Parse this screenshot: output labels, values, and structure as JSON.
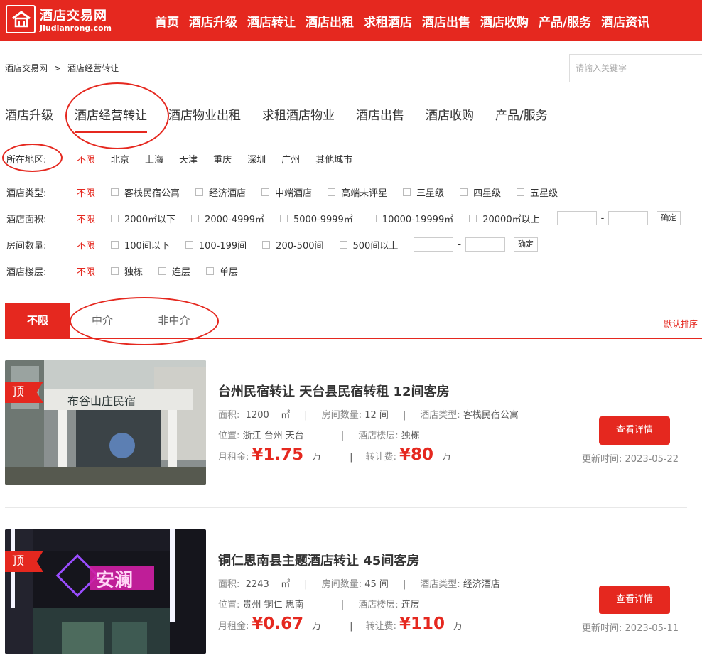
{
  "header": {
    "logo_cn": "酒店交易网",
    "logo_en": "Jiudianrong.com",
    "nav": [
      "首页",
      "酒店升级",
      "酒店转让",
      "酒店出租",
      "求租酒店",
      "酒店出售",
      "酒店收购",
      "产品/服务",
      "酒店资讯"
    ]
  },
  "breadcrumb": {
    "home": "酒店交易网",
    "sep": ">",
    "current": "酒店经营转让"
  },
  "search": {
    "placeholder": "请输入关键字"
  },
  "category_tabs": [
    "酒店升级",
    "酒店经营转让",
    "酒店物业出租",
    "求租酒店物业",
    "酒店出售",
    "酒店收购",
    "产品/服务"
  ],
  "filters": {
    "region": {
      "label": "所在地区:",
      "options": [
        "不限",
        "北京",
        "上海",
        "天津",
        "重庆",
        "深圳",
        "广州",
        "其他城市"
      ]
    },
    "type": {
      "label": "酒店类型:",
      "any": "不限",
      "options": [
        "客栈民宿公寓",
        "经济酒店",
        "中端酒店",
        "高端未评星",
        "三星级",
        "四星级",
        "五星级"
      ]
    },
    "area": {
      "label": "酒店面积:",
      "any": "不限",
      "options": [
        "2000㎡以下",
        "2000-4999㎡",
        "5000-9999㎡",
        "10000-19999㎡",
        "20000㎡以上"
      ],
      "confirm": "确定",
      "dash": "-"
    },
    "rooms": {
      "label": "房间数量:",
      "any": "不限",
      "options": [
        "100间以下",
        "100-199间",
        "200-500间",
        "500间以上"
      ],
      "confirm": "确定",
      "dash": "-"
    },
    "floors": {
      "label": "酒店楼层:",
      "any": "不限",
      "options": [
        "独栋",
        "连层",
        "单层"
      ]
    }
  },
  "type_tabs": [
    "不限",
    "中介",
    "非中介"
  ],
  "sort_label": "默认排序",
  "listings": [
    {
      "badge": "顶",
      "title": "台州民宿转让 天台县民宿转租 12间客房",
      "area_label": "面积:",
      "area": "1200",
      "area_unit": "㎡",
      "rooms_label": "房间数量:",
      "rooms": "12 间",
      "type_label": "酒店类型:",
      "type": "客栈民宿公寓",
      "loc_label": "位置:",
      "loc": "浙江 台州 天台",
      "floor_label": "酒店楼层:",
      "floor": "独栋",
      "rent_label": "月租金:",
      "rent": "¥1.75",
      "rent_unit": "万",
      "fee_label": "转让费:",
      "fee": "¥80",
      "fee_unit": "万",
      "detail": "查看详情",
      "updated_label": "更新时间:",
      "updated": "2023-05-22"
    },
    {
      "badge": "顶",
      "title": "铜仁思南县主题酒店转让 45间客房",
      "area_label": "面积:",
      "area": "2243",
      "area_unit": "㎡",
      "rooms_label": "房间数量:",
      "rooms": "45 间",
      "type_label": "酒店类型:",
      "type": "经济酒店",
      "loc_label": "位置:",
      "loc": "贵州 铜仁 思南",
      "floor_label": "酒店楼层:",
      "floor": "连层",
      "rent_label": "月租金:",
      "rent": "¥0.67",
      "rent_unit": "万",
      "fee_label": "转让费:",
      "fee": "¥110",
      "fee_unit": "万",
      "detail": "查看详情",
      "updated_label": "更新时间:",
      "updated": "2023-05-11"
    }
  ],
  "images": {
    "listing_1_sign": "布谷山庄民宿",
    "listing_2_sign": "安澜"
  },
  "colors": {
    "brand": "#e5281f"
  }
}
